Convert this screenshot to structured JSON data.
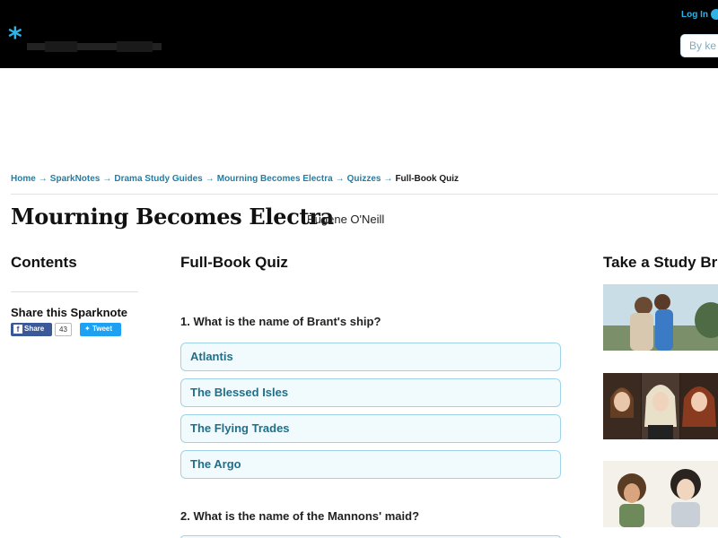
{
  "header": {
    "logo_asterisk": "*",
    "login_label": "Log In",
    "search_placeholder": "By ke"
  },
  "breadcrumb": {
    "items": [
      "Home",
      "SparkNotes",
      "Drama Study Guides",
      "Mourning Becomes Electra",
      "Quizzes"
    ],
    "separator": "→",
    "current": "Full-Book Quiz"
  },
  "title": {
    "book": "Mourning Becomes Electra",
    "author": "Eugene O'Neill"
  },
  "left": {
    "contents_heading": "Contents",
    "share_heading": "Share this Sparknote",
    "share_label": "Share",
    "share_count": "43",
    "tweet_label": "Tweet"
  },
  "quiz": {
    "heading": "Full-Book Quiz",
    "questions": [
      {
        "text": "1. What is the name of Brant's ship?",
        "answers": [
          "Atlantis",
          "The Blessed Isles",
          "The Flying Trades",
          "The Argo"
        ]
      },
      {
        "text": "2. What is the name of the Mannons' maid?",
        "answers": []
      }
    ]
  },
  "right": {
    "heading": "Take a Study Br"
  },
  "colors": {
    "header_bg": "#000000",
    "accent": "#2fb3e6",
    "link": "#1f7fa6",
    "answer_border": "#9fd4e8",
    "answer_bg": "#f1fbfd",
    "answer_text": "#1f6f8b",
    "facebook": "#3b5998",
    "twitter": "#1da1f2"
  }
}
